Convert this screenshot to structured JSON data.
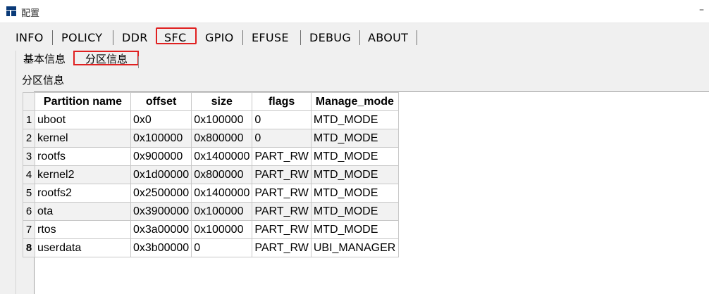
{
  "window": {
    "title": "配置",
    "minimize_glyph": "–"
  },
  "main_tabs": [
    "INFO",
    "POLICY",
    "DDR",
    "SFC",
    "GPIO",
    "EFUSE",
    "DEBUG",
    "ABOUT"
  ],
  "active_main_tab": "SFC",
  "sub_tabs": [
    "基本信息",
    "分区信息"
  ],
  "active_sub_tab": "分区信息",
  "section_label": "分区信息",
  "table": {
    "columns": [
      "Partition name",
      "offset",
      "size",
      "flags",
      "Manage_mode"
    ],
    "rows": [
      {
        "num": "1",
        "cells": [
          "uboot",
          "0x0",
          "0x100000",
          "0",
          "MTD_MODE"
        ]
      },
      {
        "num": "2",
        "cells": [
          "kernel",
          "0x100000",
          "0x800000",
          "0",
          "MTD_MODE"
        ]
      },
      {
        "num": "3",
        "cells": [
          "rootfs",
          "0x900000",
          "0x1400000",
          "PART_RW",
          "MTD_MODE"
        ]
      },
      {
        "num": "4",
        "cells": [
          "kernel2",
          "0x1d00000",
          "0x800000",
          "PART_RW",
          "MTD_MODE"
        ]
      },
      {
        "num": "5",
        "cells": [
          "rootfs2",
          "0x2500000",
          "0x1400000",
          "PART_RW",
          "MTD_MODE"
        ]
      },
      {
        "num": "6",
        "cells": [
          "ota",
          "0x3900000",
          "0x100000",
          "PART_RW",
          "MTD_MODE"
        ]
      },
      {
        "num": "7",
        "cells": [
          "rtos",
          "0x3a00000",
          "0x100000",
          "PART_RW",
          "MTD_MODE"
        ]
      },
      {
        "num": "8",
        "cells": [
          "userdata",
          "0x3b00000",
          "0",
          "PART_RW",
          "UBI_MANAGER"
        ]
      }
    ],
    "current_row": "8"
  },
  "colors": {
    "highlight": "#e02020",
    "app_icon": "#0a3a78"
  },
  "icons": {
    "app": "app-logo-icon"
  }
}
